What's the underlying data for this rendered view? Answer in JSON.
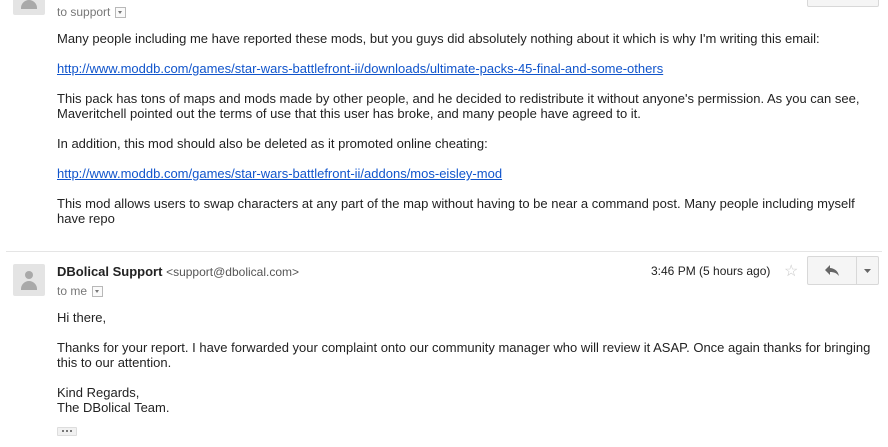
{
  "message1": {
    "recipient": "to support",
    "paragraphs": {
      "p1": "Many people including me have reported these mods, but you guys did absolutely nothing about it which is why I'm writing this email:",
      "link1": "http://www.moddb.com/games/star-wars-battlefront-ii/downloads/ultimate-packs-45-final-and-some-others",
      "p2": "This pack has tons of maps and mods made by other people, and he decided to redistribute it without anyone's permission. As you can see, Maveritchell pointed out the terms of use that this user has broke, and many people have agreed to it.",
      "p3": "In addition, this mod should also be deleted as it promoted online cheating:",
      "link2": "http://www.moddb.com/games/star-wars-battlefront-ii/addons/mos-eisley-mod",
      "p4": "This mod allows users to swap characters at any part of the map without having to be near a command post. Many people including myself have repo"
    }
  },
  "message2": {
    "sender_name": "DBolical Support",
    "sender_email": "<support@dbolical.com>",
    "time": "3:46 PM (5 hours ago)",
    "recipient": "to me",
    "greeting": "Hi there,",
    "body": "Thanks for your report. I have forwarded your complaint onto our community manager who will review it ASAP. Once again thanks for bringing this to our attention.",
    "signoff_line1": "Kind Regards,",
    "signoff_line2": "The DBolical Team."
  },
  "icons": {
    "avatar": "person-icon",
    "star": "star-icon",
    "reply": "reply-icon",
    "more": "chevron-down-icon",
    "expand": "ellipsis-icon"
  },
  "colors": {
    "link": "#1155cc",
    "text": "#222222",
    "muted": "#777777"
  }
}
